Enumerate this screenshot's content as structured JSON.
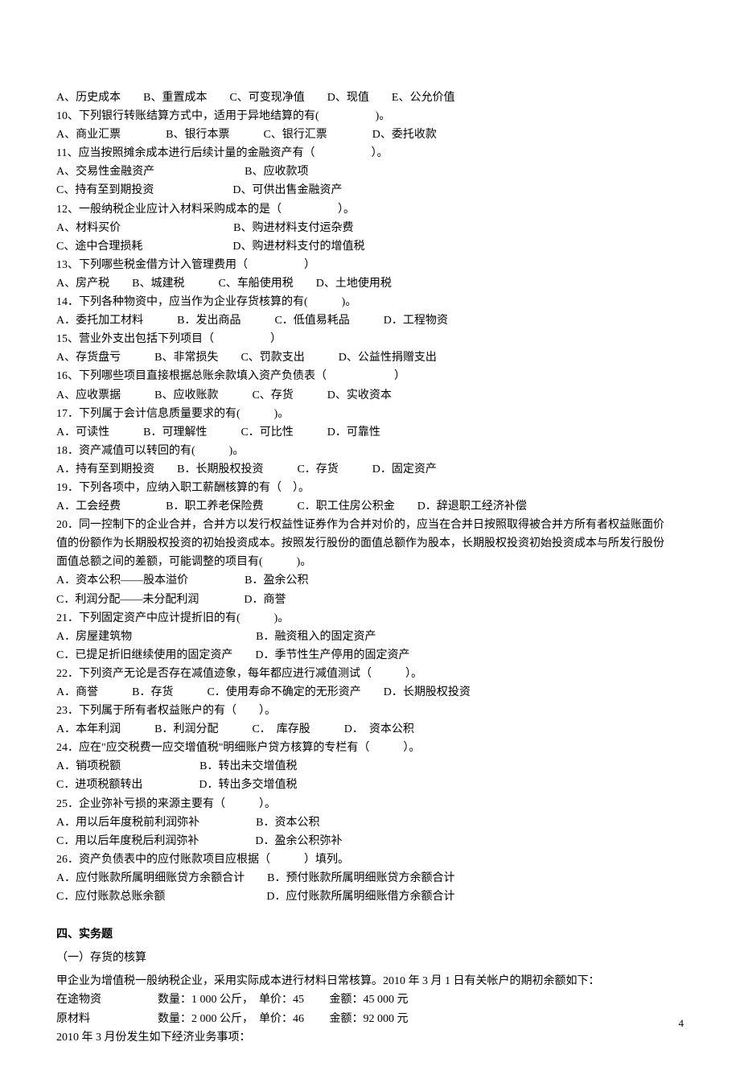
{
  "q9_opts": "A、历史成本　　B、重置成本　　C、可变现净值　　D、现值　　E、公允价值",
  "q10": "10、下列银行转账结算方式中，适用于异地结算的有(　　　　　)。",
  "q10_opts": "A、商业汇票　　　　B、银行本票　　　C、银行汇票　　　　D、委托收款",
  "q11": "11、应当按照摊余成本进行后续计量的金融资产有（　　　　　）。",
  "q11_opts_a": "A、交易性金融资产　　　　　　　　B、应收款项",
  "q11_opts_b": "C、持有至到期投资　　　　　　　D、可供出售金融资产",
  "q12": "12、一般纳税企业应计入材料采购成本的是（　　　　　）。",
  "q12_opts_a": "A、材料买价　　　　　　　　　　B、购进材料支付运杂费",
  "q12_opts_b": "C、途中合理损耗　　　　　　　　D、购进材料支付的增值税",
  "q13": "13、下列哪些税金借方计入管理费用（　　　　　）",
  "q13_opts": "A、房产税　　B、城建税　　　C、车船使用税　　D、土地使用税",
  "q14": "14．下列各种物资中，应当作为企业存货核算的有(　　　)。",
  "q14_opts": "A．委托加工材料　　　B．发出商品　　　C．低值易耗品　　　D．工程物资",
  "q15": "15、营业外支出包括下列项目（　　　　　）",
  "q15_opts": "A、存货盘亏　　　B、非常损失　　C、罚款支出　　　D、公益性捐赠支出",
  "q16": "16、下列哪些项目直接根据总账余款填入资产负债表（　　　　　　）",
  "q16_opts": "A、应收票据　　　B、应收账款　　　C、存货　　　D、实收资本",
  "q17": "17．下列属于会计信息质量要求的有(　　　)。",
  "q17_opts": "A．可读性　　　B．可理解性　　　C．可比性　　　D．可靠性",
  "q18": "18．资产减值可以转回的有(　　　)。",
  "q18_opts": "A．持有至到期投资　　B．长期股权投资　　　C．存货　　　D．固定资产",
  "q19": "19．下列各项中，应纳入职工薪酬核算的有（　）。",
  "q19_opts": "A．工会经费　　　　B．职工养老保险费　　　C．职工住房公积金　　D．辞退职工经济补偿",
  "q20_l1": "20．同一控制下的企业合并，合并方以发行权益性证券作为合并对价的，应当在合并日按照取得被合并方所有者权益账面价",
  "q20_l2": "值的份额作为长期股权投资的初始投资成本。按照发行股份的面值总额作为股本，长期股权投资初始投资成本与所发行股份",
  "q20_l3": "面值总额之间的差额，可能调整的项目有(　　　)。",
  "q20_opts_a": "A．资本公积——股本溢价　　　　　B．盈余公积",
  "q20_opts_b": "C．利润分配——未分配利润　　　　D．商誉",
  "q21": "21．下列固定资产中应计提折旧的有(　　　)。",
  "q21_opts_a": "A．房屋建筑物　　　　　　　　　　　B．融资租入的固定资产",
  "q21_opts_b": "C．已提足折旧继续使用的固定资产　　D．季节性生产停用的固定资产",
  "q22": "22．下列资产无论是否存在减值迹象，每年都应进行减值测试（　　　）。",
  "q22_opts": "A．商誉　　　B．存货　　　C．使用寿命不确定的无形资产　　D．长期股权投资",
  "q23": "23．下列属于所有者权益账户的有（　　）。",
  "q23_opts": "A．本年利润　　　B．利润分配　　　C．　库存股　　　D．　资本公积",
  "q24": "24．应在\"应交税费一应交增值税\"明细账户贷方核算的专栏有（　　　）。",
  "q24_opts_a": "A．销项税额　　　　　　　B．转出未交增值税",
  "q24_opts_b": "C．进项税额转出　　　　　D．转出多交增值税",
  "q25": "25．企业弥补亏损的来源主要有（　　　）。",
  "q25_opts_a": "A．用以后年度税前利润弥补　　　　　B．资本公积",
  "q25_opts_b": "C．用以后年度税后利润弥补　　　　　D．盈余公积弥补",
  "q26": "26．资产负债表中的应付账款项目应根据（　　　）填列。",
  "q26_opts_a": "A．应付账款所属明细账贷方余额合计　　B．预付账款所属明细账贷方余额合计",
  "q26_opts_b": "C．应付账款总账余额　　　　　　　　　D．应付账款所属明细账借方余额合计",
  "section4": "四、实务题",
  "p1_title": "（一）存货的核算",
  "p1_l1": "甲企业为增值税一般纳税企业，采用实际成本进行材料日常核算。2010 年 3 月 1 日有关帐户的期初余额如下：",
  "p1_l2": "在途物资　　　　　数量：1 000 公斤，　单价：45　　 金额：45 000 元",
  "p1_l3": "原材料　　　　　　数量：2 000 公斤，　单价：46　　 金额：92 000 元",
  "p1_l4": "2010 年 3 月份发生如下经济业务事项：",
  "page_number": "4"
}
